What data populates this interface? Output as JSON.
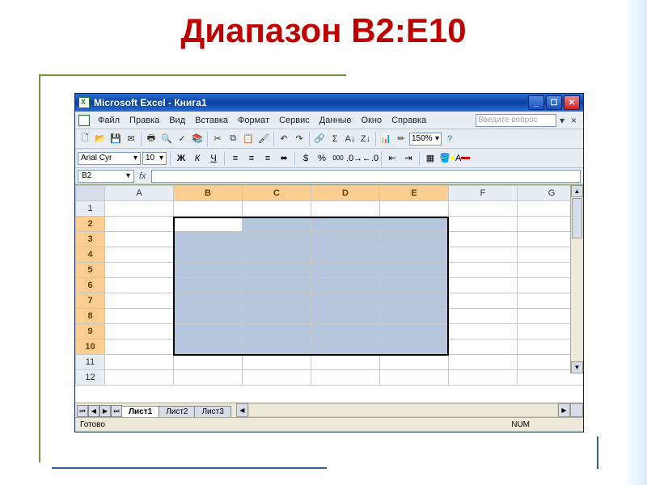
{
  "slide": {
    "title": "Диапазон B2:E10"
  },
  "window": {
    "title": "Microsoft Excel - Книга1"
  },
  "menu": {
    "file": "Файл",
    "edit": "Правка",
    "view": "Вид",
    "insert": "Вставка",
    "format": "Формат",
    "tools": "Сервис",
    "data": "Данные",
    "window": "Окно",
    "help": "Справка",
    "ask_placeholder": "Введите вопрос"
  },
  "toolbar": {
    "zoom": "150%"
  },
  "format_toolbar": {
    "font": "Arial Cyr",
    "size": "10",
    "bold": "Ж",
    "italic": "К",
    "under": "Ч",
    "currency": "%",
    "sep": "000"
  },
  "namebox": {
    "ref": "B2",
    "fx": "fx"
  },
  "columns": [
    "A",
    "B",
    "C",
    "D",
    "E",
    "F",
    "G"
  ],
  "rows": [
    "1",
    "2",
    "3",
    "4",
    "5",
    "6",
    "7",
    "8",
    "9",
    "10",
    "11",
    "12"
  ],
  "selection": {
    "active": "B2",
    "range_cols": [
      1,
      4
    ],
    "range_rows": [
      1,
      9
    ]
  },
  "tabs": {
    "nav": [
      "⏮",
      "◀",
      "▶",
      "⏭"
    ],
    "sheets": [
      "Лист1",
      "Лист2",
      "Лист3"
    ],
    "active": 0
  },
  "status": {
    "left": "Готово",
    "num": "NUM"
  }
}
